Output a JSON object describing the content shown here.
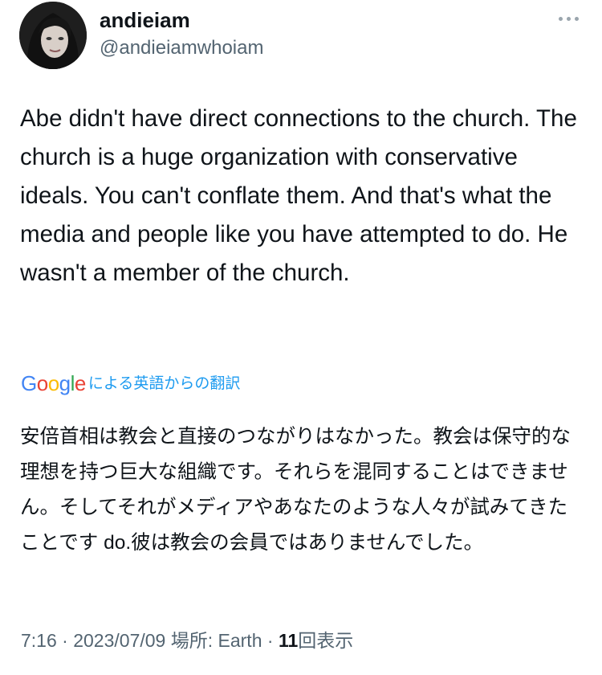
{
  "author": {
    "display_name": "andieiam",
    "handle": "@andieiamwhoiam"
  },
  "tweet": {
    "text": "Abe didn't have direct connections to the church. The church is a huge organization with conservative ideals. You can't conflate them. And that's what the media and people like you have attempted to do. He wasn't a member of the church."
  },
  "translation": {
    "provider_letters": [
      "G",
      "o",
      "o",
      "g",
      "l",
      "e"
    ],
    "provider_colors": [
      "#4285F4",
      "#EA4335",
      "#FBBC05",
      "#4285F4",
      "#34A853",
      "#EA4335"
    ],
    "label": "による英語からの翻訳",
    "text": "安倍首相は教会と直接のつながりはなかった。教会は保守的な理想を持つ巨大な組織です。それらを混同することはできません。そしてそれがメディアやあなたのような人々が試みてきたことです do.彼は教会の会員ではありませんでした。"
  },
  "meta": {
    "time": "7:16",
    "separator": "·",
    "date": "2023/07/09",
    "location_label": "場所:",
    "location": "Earth",
    "views_count": "11",
    "views_label": "回表示"
  },
  "colors": {
    "accent": "#1d9bf0",
    "secondary_text": "#536471",
    "primary_text": "#0f1419"
  },
  "icons": {
    "more": "more-horizontal-icon"
  }
}
